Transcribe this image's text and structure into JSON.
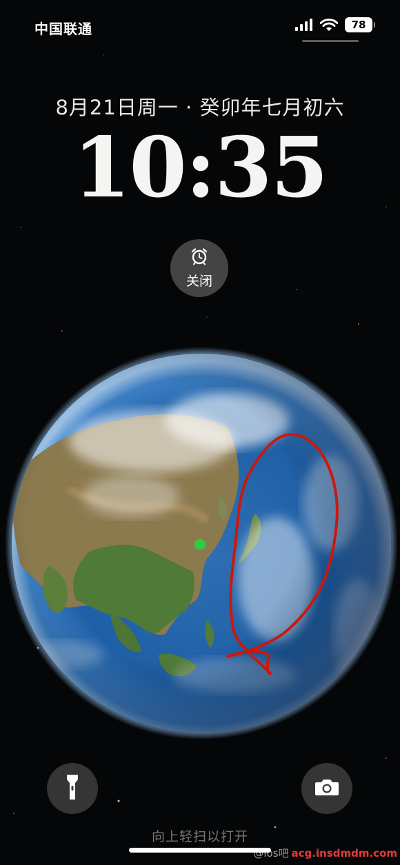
{
  "status_bar": {
    "carrier": "中国联通",
    "battery_level": "78",
    "icons": [
      "signal-icon",
      "wifi-icon",
      "battery-icon"
    ]
  },
  "lock_screen": {
    "date_line": "8月21日周一 · 癸卯年七月初六",
    "time": "10:35",
    "alarm": {
      "label": "关闭",
      "icon": "alarm-clock-icon"
    },
    "swipe_hint": "向上轻扫以打开"
  },
  "quick_actions": {
    "left": "flashlight-icon",
    "right": "camera-icon"
  },
  "wallpaper": {
    "subject": "earth-globe-icon",
    "location_marker_color": "#2ecc40",
    "annotation_color": "#c8190f"
  },
  "watermark": {
    "user": "@ios吧",
    "site": "acg.insdmdm.com"
  },
  "colors": {
    "background": "#050607",
    "widget_bg": "#777777",
    "battery_bg": "#ffffff"
  }
}
